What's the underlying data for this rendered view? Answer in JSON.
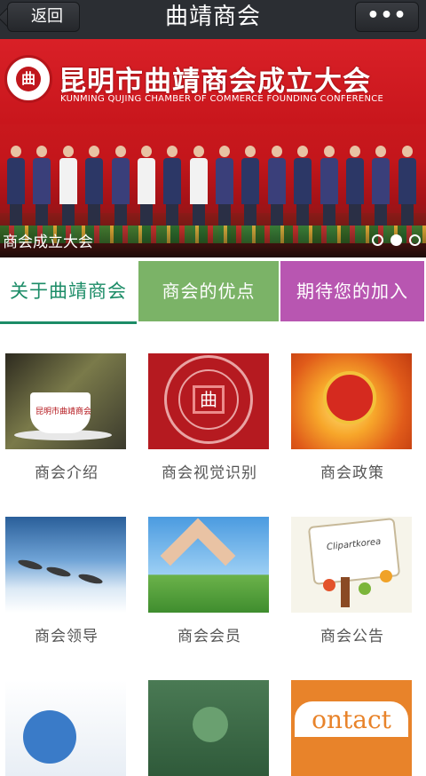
{
  "topbar": {
    "back_label": "返回",
    "title": "曲靖商会",
    "more_label": "•••"
  },
  "banner": {
    "heading": "昆明市曲靖商会成立大会",
    "subheading": "KUNMING QUJING CHAMBER OF COMMERCE FOUNDING CONFERENCE",
    "seal_glyph": "曲",
    "caption": "商会成立大会",
    "slides_total": 3,
    "active_slide": 2
  },
  "tabs": [
    {
      "label": "关于曲靖商会",
      "color": "#1c8c67",
      "active": true
    },
    {
      "label": "商会的优点",
      "color": "#7bb367",
      "active": false
    },
    {
      "label": "期待您的加入",
      "color": "#b856b1",
      "active": false
    }
  ],
  "grid": [
    {
      "label": "商会介绍",
      "icon": "coffee-cup-image",
      "thumb_text": "昆明市曲靖商会"
    },
    {
      "label": "商会视觉识别",
      "icon": "chamber-logo-image",
      "thumb_text": "曲"
    },
    {
      "label": "商会政策",
      "icon": "national-emblem-image"
    },
    {
      "label": "商会领导",
      "icon": "flying-birds-image"
    },
    {
      "label": "商会会员",
      "icon": "hands-roof-image"
    },
    {
      "label": "商会公告",
      "icon": "notice-tree-image",
      "thumb_text": "Clipartkorea"
    },
    {
      "label": "",
      "icon": "network-globe-image"
    },
    {
      "label": "",
      "icon": "green-abstract-image"
    },
    {
      "label": "",
      "icon": "contact-image",
      "thumb_text": "ontact"
    }
  ],
  "colors": {
    "topbar": "#2b2e33",
    "banner_red": "#c8161c"
  }
}
